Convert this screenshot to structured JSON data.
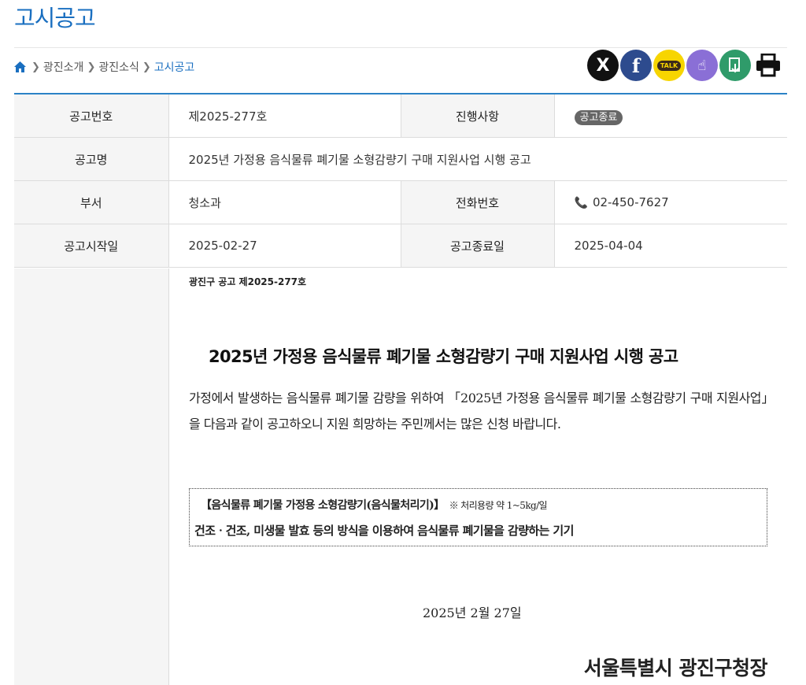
{
  "page": {
    "title": "고시공고"
  },
  "breadcrumb": {
    "items": [
      "광진소개",
      "광진소식"
    ],
    "current": "고시공고"
  },
  "share": {
    "x": "X",
    "facebook": "f",
    "kakao": "TALK",
    "icons": [
      "x-icon",
      "facebook-icon",
      "kakaotalk-icon",
      "touch-icon",
      "document-icon",
      "print-icon"
    ]
  },
  "info": {
    "labels": {
      "number": "공고번호",
      "status": "진행사항",
      "name": "공고명",
      "dept": "부서",
      "phone": "전화번호",
      "start": "공고시작일",
      "end": "공고종료일"
    },
    "number": "제2025-277호",
    "status": "공고종료",
    "name": "2025년 가정용 음식물류 폐기물 소형감량기 구매 지원사업 시행 공고",
    "dept": "청소과",
    "phone": "02-450-7627",
    "start": "2025-02-27",
    "end": "2025-04-04"
  },
  "doc": {
    "no": "광진구 공고 제2025-277호",
    "title": "2025년 가정용 음식물류 폐기물 소형감량기 구매 지원사업 시행 공고",
    "body": "가정에서 발생하는 음식물류 폐기물 감량을 위하여 「2025년 가정용 음식물류 폐기물 소형감량기 구매 지원사업」을 다음과 같이 공고하오니 지원 희망하는 주민께서는 많은 신청 바랍니다.",
    "box_line1": "【음식물류 폐기물 가정용 소형감량기(음식물처리기)】",
    "box_note": "※ 처리용량 약 1~5kg/일",
    "box_line2": "건조ㆍ건조, 미생물 발효 등의 방식을 이용하여 음식물류 폐기물을 감량하는 기기",
    "date": "2025년 2월 27일",
    "signer": "서울특별시 광진구청장"
  },
  "colors": {
    "accent": "#1a6fc0",
    "rule": "#2b82c6",
    "badge": "#666666"
  }
}
